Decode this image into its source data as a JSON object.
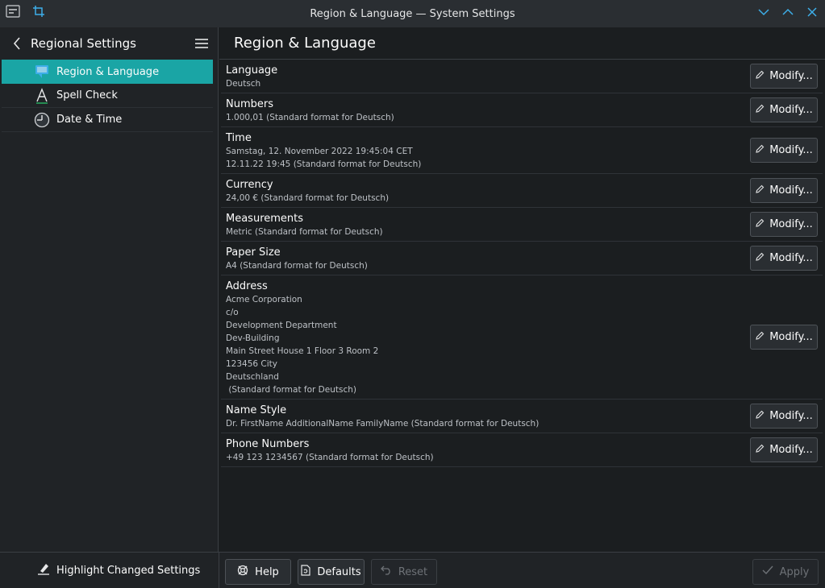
{
  "window": {
    "title": "Region & Language — System Settings"
  },
  "sidebar": {
    "title": "Regional Settings",
    "items": [
      {
        "label": "Region & Language",
        "icon": "region-flag-icon",
        "active": true
      },
      {
        "label": "Spell Check",
        "icon": "spell-check-icon",
        "active": false
      },
      {
        "label": "Date & Time",
        "icon": "clock-icon",
        "active": false
      }
    ]
  },
  "main": {
    "title": "Region & Language",
    "modify_label": "Modify...",
    "rows": [
      {
        "title": "Language",
        "values": [
          "Deutsch"
        ]
      },
      {
        "title": "Numbers",
        "values": [
          "1.000,01 (Standard format for Deutsch)"
        ]
      },
      {
        "title": "Time",
        "values": [
          "Samstag, 12. November 2022 19:45:04 CET",
          "12.11.22 19:45 (Standard format for Deutsch)"
        ]
      },
      {
        "title": "Currency",
        "values": [
          "24,00 € (Standard format for Deutsch)"
        ]
      },
      {
        "title": "Measurements",
        "values": [
          "Metric (Standard format for Deutsch)"
        ]
      },
      {
        "title": "Paper Size",
        "values": [
          "A4 (Standard format for Deutsch)"
        ]
      },
      {
        "title": "Address",
        "values": [
          "Acme Corporation",
          "c/o",
          "Development Department",
          "Dev-Building",
          "Main Street House 1 Floor 3 Room 2",
          "123456 City",
          "Deutschland",
          " (Standard format for Deutsch)"
        ]
      },
      {
        "title": "Name Style",
        "values": [
          "Dr. FirstName AdditionalName FamilyName (Standard format for Deutsch)"
        ]
      },
      {
        "title": "Phone Numbers",
        "values": [
          "+49 123 1234567 (Standard format for Deutsch)"
        ]
      }
    ]
  },
  "footer": {
    "highlight_label": "Highlight Changed Settings",
    "help_label": "Help",
    "defaults_label": "Defaults",
    "reset_label": "Reset",
    "apply_label": "Apply"
  },
  "colors": {
    "accent": "#1aa5a5",
    "background": "#1b1e20",
    "sidebar": "#202326"
  }
}
